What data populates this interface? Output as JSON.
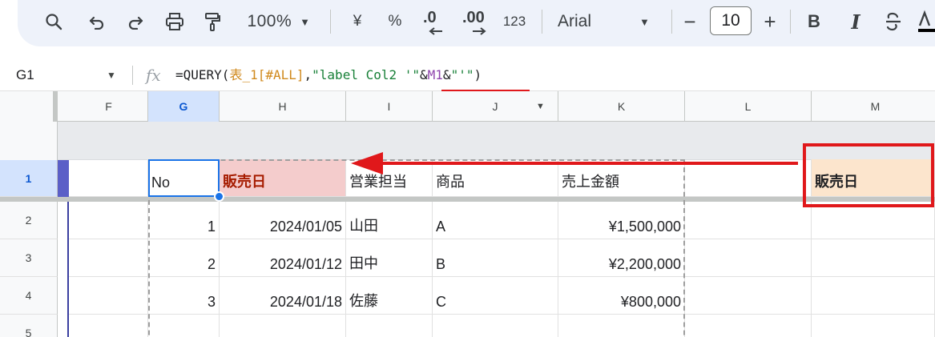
{
  "toolbar": {
    "zoom": "100%",
    "currency": "¥",
    "percent": "%",
    "decrease_decimal": ".0",
    "increase_decimal": ".00",
    "number_format": "123",
    "font": "Arial",
    "font_size": "10",
    "minus": "−",
    "plus": "+",
    "bold": "B",
    "italic": "I"
  },
  "formula_bar": {
    "cell_ref": "G1",
    "fx": "fx",
    "formula_prefix": "=QUERY(",
    "formula_table": "表_1[#ALL]",
    "formula_comma": ",",
    "formula_str1": "\"label Col2 '\"",
    "formula_amp1": "&",
    "formula_ref": "M1",
    "formula_amp2": "&",
    "formula_str2": "\"'\"",
    "formula_close": ")"
  },
  "columns": [
    "F",
    "G",
    "H",
    "I",
    "J",
    "K",
    "L",
    "M"
  ],
  "rows": [
    "1",
    "2",
    "3",
    "4",
    "5"
  ],
  "header_row": {
    "no": "No",
    "sales_date": "販売日",
    "rep": "営業担当",
    "product": "商品",
    "amount": "売上金額",
    "m1": "販売日"
  },
  "data_rows": [
    {
      "no": "1",
      "date": "2024/01/05",
      "rep": "山田",
      "product": "A",
      "amount": "¥1,500,000"
    },
    {
      "no": "2",
      "date": "2024/01/12",
      "rep": "田中",
      "product": "B",
      "amount": "¥2,200,000"
    },
    {
      "no": "3",
      "date": "2024/01/18",
      "rep": "佐藤",
      "product": "C",
      "amount": "¥800,000"
    }
  ],
  "colors": {
    "accent": "#1a73e8",
    "annotation": "#e0181b",
    "header_pink": "#f4cccc",
    "header_peach": "#fce5cd"
  }
}
